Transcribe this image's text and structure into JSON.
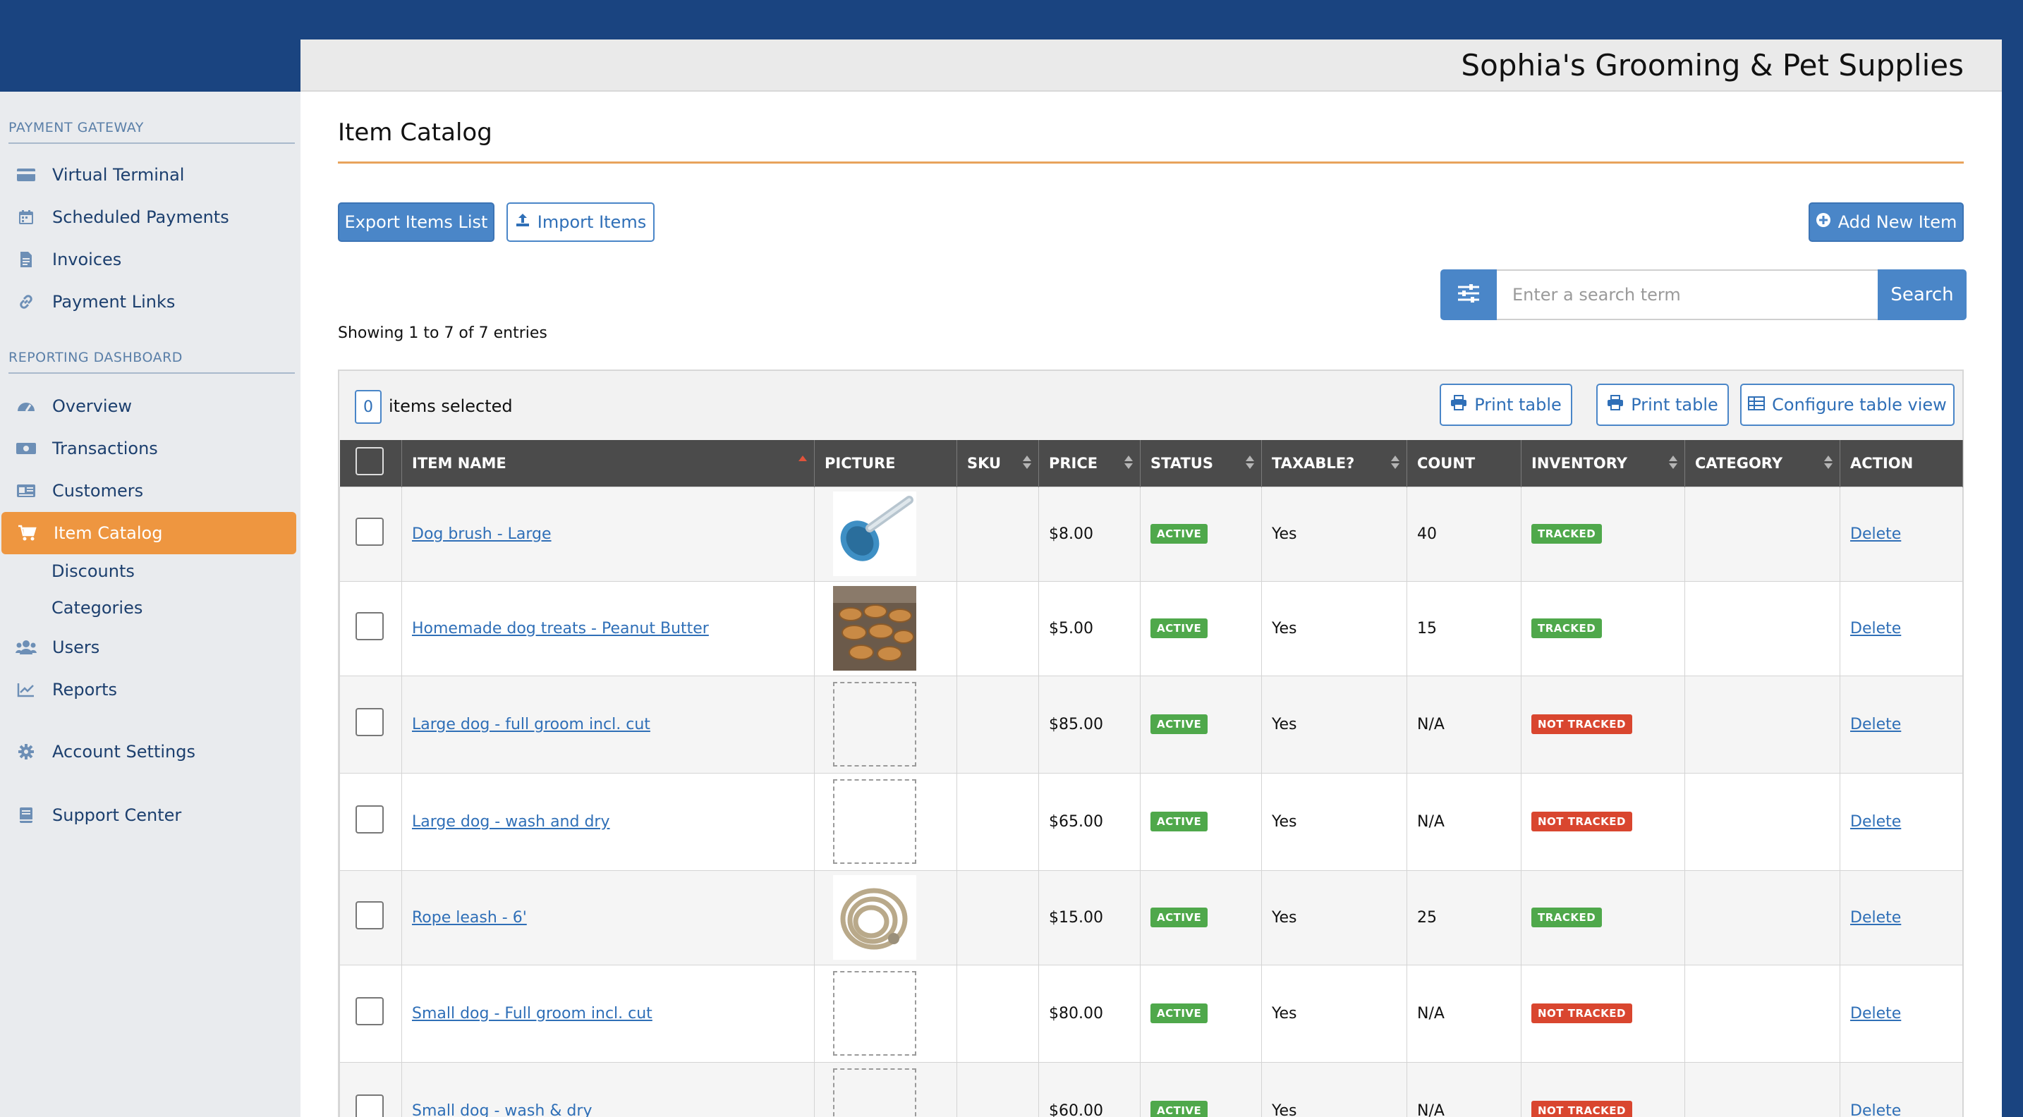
{
  "business_name": "Sophia's Grooming & Pet Supplies",
  "sidebar": {
    "sections": [
      {
        "title": "PAYMENT GATEWAY"
      },
      {
        "title": "REPORTING DASHBOARD"
      }
    ],
    "items": [
      {
        "label": "Virtual Terminal",
        "icon": "credit-card-icon"
      },
      {
        "label": "Scheduled Payments",
        "icon": "calendar-icon"
      },
      {
        "label": "Invoices",
        "icon": "document-icon"
      },
      {
        "label": "Payment Links",
        "icon": "link-icon"
      },
      {
        "label": "Overview",
        "icon": "dashboard-icon"
      },
      {
        "label": "Transactions",
        "icon": "money-icon"
      },
      {
        "label": "Customers",
        "icon": "id-card-icon"
      },
      {
        "label": "Item Catalog",
        "icon": "cart-icon",
        "active": true
      },
      {
        "label": "Users",
        "icon": "users-icon"
      },
      {
        "label": "Reports",
        "icon": "line-chart-icon"
      },
      {
        "label": "Account Settings",
        "icon": "gear-icon"
      },
      {
        "label": "Support Center",
        "icon": "book-icon"
      }
    ],
    "subitems": [
      {
        "label": "Discounts"
      },
      {
        "label": "Categories"
      }
    ]
  },
  "page": {
    "title": "Item Catalog",
    "export_label": "Export Items List",
    "import_label": "Import Items",
    "add_label": "Add New Item",
    "search_placeholder": "Enter a search term",
    "search_label": "Search",
    "showing": "Showing 1 to 7 of 7 entries",
    "selected_count": "0",
    "selected_label": "items selected",
    "print_label_1": "Print table",
    "print_label_2": "Print table",
    "configure_label": "Configure table view"
  },
  "table": {
    "columns": [
      "ITEM NAME",
      "PICTURE",
      "SKU",
      "PRICE",
      "STATUS",
      "TAXABLE?",
      "COUNT",
      "INVENTORY",
      "CATEGORY",
      "ACTION"
    ],
    "rows": [
      {
        "name": "Dog brush - Large",
        "picture": "dog-brush",
        "sku": "",
        "price": "$8.00",
        "status": "ACTIVE",
        "taxable": "Yes",
        "count": "40",
        "inventory": "TRACKED",
        "category": "",
        "action": "Delete"
      },
      {
        "name": "Homemade dog treats - Peanut Butter",
        "picture": "dog-treats",
        "sku": "",
        "price": "$5.00",
        "status": "ACTIVE",
        "taxable": "Yes",
        "count": "15",
        "inventory": "TRACKED",
        "category": "",
        "action": "Delete"
      },
      {
        "name": "Large dog - full groom incl. cut",
        "picture": "",
        "sku": "",
        "price": "$85.00",
        "status": "ACTIVE",
        "taxable": "Yes",
        "count": "N/A",
        "inventory": "NOT TRACKED",
        "category": "",
        "action": "Delete"
      },
      {
        "name": "Large dog - wash and dry",
        "picture": "",
        "sku": "",
        "price": "$65.00",
        "status": "ACTIVE",
        "taxable": "Yes",
        "count": "N/A",
        "inventory": "NOT TRACKED",
        "category": "",
        "action": "Delete"
      },
      {
        "name": "Rope leash - 6'",
        "picture": "rope-leash",
        "sku": "",
        "price": "$15.00",
        "status": "ACTIVE",
        "taxable": "Yes",
        "count": "25",
        "inventory": "TRACKED",
        "category": "",
        "action": "Delete"
      },
      {
        "name": "Small dog - Full groom incl. cut",
        "picture": "",
        "sku": "",
        "price": "$80.00",
        "status": "ACTIVE",
        "taxable": "Yes",
        "count": "N/A",
        "inventory": "NOT TRACKED",
        "category": "",
        "action": "Delete"
      },
      {
        "name": "Small dog - wash & dry",
        "picture": "",
        "sku": "",
        "price": "$60.00",
        "status": "ACTIVE",
        "taxable": "Yes",
        "count": "N/A",
        "inventory": "NOT TRACKED",
        "category": "",
        "action": "Delete"
      }
    ]
  },
  "colors": {
    "brand_navy": "#1a4480",
    "accent_blue": "#4a86c8",
    "active_orange": "#ee9640",
    "status_green": "#4fa84b",
    "status_red": "#d9462f"
  }
}
